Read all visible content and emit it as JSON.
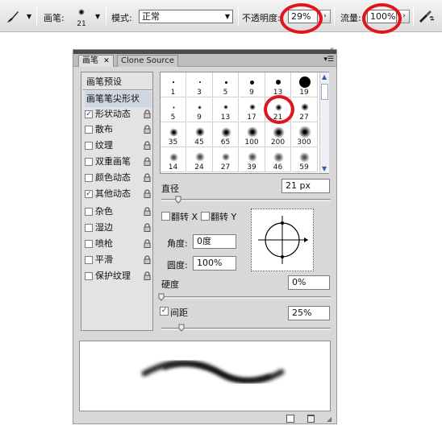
{
  "toolbar": {
    "brush_tool_icon": "brush-icon",
    "brush_label": "画笔:",
    "brush_size": "21",
    "mode_label": "模式:",
    "mode_value": "正常",
    "opacity_label": "不透明度:",
    "opacity_value": "29%",
    "flow_label": "流量:",
    "flow_value": "100%",
    "airbrush_icon": "airbrush-icon"
  },
  "panel": {
    "tabs": [
      {
        "label": "画笔"
      },
      {
        "label": "Clone Source"
      }
    ],
    "preset_header": "画笔预设",
    "tip_shape": "画笔笔尖形状",
    "options": [
      {
        "label": "形状动态",
        "checked": true
      },
      {
        "label": "散布",
        "checked": false
      },
      {
        "label": "纹理",
        "checked": false
      },
      {
        "label": "双重画笔",
        "checked": false
      },
      {
        "label": "颜色动态",
        "checked": false
      },
      {
        "label": "其他动态",
        "checked": true
      },
      {
        "label": "杂色",
        "checked": false
      },
      {
        "label": "湿边",
        "checked": false
      },
      {
        "label": "喷枪",
        "checked": false
      },
      {
        "label": "平滑",
        "checked": false
      },
      {
        "label": "保护纹理",
        "checked": false
      }
    ],
    "brushes": [
      {
        "size": "1",
        "soft": false
      },
      {
        "size": "3",
        "soft": false
      },
      {
        "size": "5",
        "soft": false
      },
      {
        "size": "9",
        "soft": false
      },
      {
        "size": "13",
        "soft": false
      },
      {
        "size": "19",
        "soft": false
      },
      {
        "size": "5",
        "soft": true
      },
      {
        "size": "9",
        "soft": true
      },
      {
        "size": "13",
        "soft": true
      },
      {
        "size": "17",
        "soft": true
      },
      {
        "size": "21",
        "soft": true
      },
      {
        "size": "27",
        "soft": true
      },
      {
        "size": "35",
        "soft": true
      },
      {
        "size": "45",
        "soft": true
      },
      {
        "size": "65",
        "soft": true
      },
      {
        "size": "100",
        "soft": true
      },
      {
        "size": "200",
        "soft": true
      },
      {
        "size": "300",
        "soft": true
      },
      {
        "size": "14",
        "soft": true
      },
      {
        "size": "24",
        "soft": true
      },
      {
        "size": "27",
        "soft": true
      },
      {
        "size": "39",
        "soft": true
      },
      {
        "size": "46",
        "soft": true
      },
      {
        "size": "59",
        "soft": true
      }
    ],
    "diameter_label": "直径",
    "diameter_value": "21 px",
    "flip_x_label": "翻转 X",
    "flip_y_label": "翻转 Y",
    "angle_label": "角度:",
    "angle_value": "0度",
    "roundness_label": "圆度:",
    "roundness_value": "100%",
    "hardness_label": "硬度",
    "hardness_value": "0%",
    "spacing_label": "间距",
    "spacing_value": "25%",
    "spacing_checked": true,
    "selected_brush": "21"
  },
  "colors": {
    "highlight_ring": "#e0141a",
    "selection": "#cfd6e4"
  }
}
